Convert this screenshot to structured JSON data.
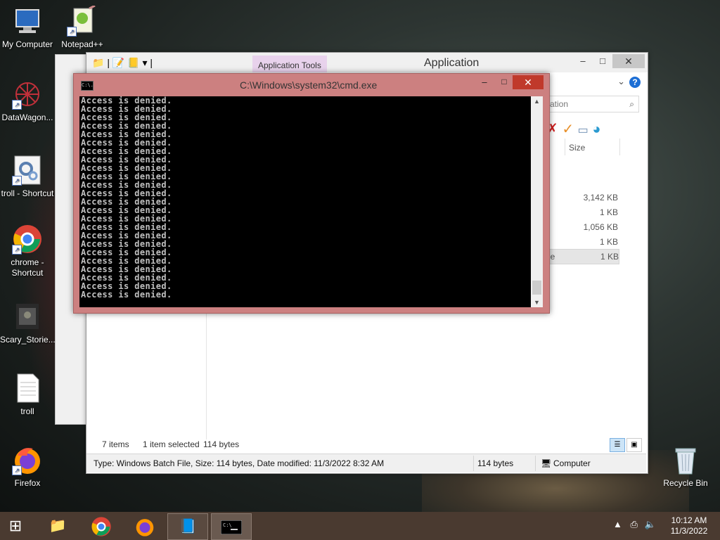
{
  "desktop": {
    "icons": [
      {
        "label": "My Computer"
      },
      {
        "label": "Notepad++"
      },
      {
        "label": "DataWagon..."
      },
      {
        "label": "troll - Shortcut"
      },
      {
        "label": "chrome - Shortcut"
      },
      {
        "label": "Scary_Storie..."
      },
      {
        "label": "troll"
      },
      {
        "label": "Firefox"
      },
      {
        "label": "Recycle Bin"
      }
    ]
  },
  "explorer": {
    "ribbon_context_tab": "Application Tools",
    "title": "Application",
    "search_fragment": "ation",
    "column_size": "Size",
    "rows": [
      {
        "size": "3,142 KB",
        "fragment": ""
      },
      {
        "size": "1 KB",
        "fragment": ""
      },
      {
        "size": "1,056 KB",
        "fragment": ""
      },
      {
        "size": "1 KB",
        "fragment": ""
      },
      {
        "size": "1 KB",
        "fragment": "le",
        "selected": true
      }
    ],
    "status": {
      "items": "7 items",
      "selected": "1 item selected",
      "selected_size": "114 bytes"
    },
    "details_bar": {
      "info": "Type: Windows Batch File, Size: 114 bytes, Date modified: 11/3/2022 8:32 AM",
      "size": "114 bytes",
      "location": "Computer"
    }
  },
  "cmd": {
    "title": "C:\\Windows\\system32\\cmd.exe",
    "lines": [
      "Access is denied.",
      "Access is denied.",
      "Access is denied.",
      "Access is denied.",
      "Access is denied.",
      "Access is denied.",
      "Access is denied.",
      "Access is denied.",
      "Access is denied.",
      "Access is denied.",
      "Access is denied.",
      "Access is denied.",
      "Access is denied.",
      "Access is denied.",
      "Access is denied.",
      "Access is denied.",
      "Access is denied.",
      "Access is denied.",
      "Access is denied.",
      "Access is denied.",
      "Access is denied.",
      "Access is denied.",
      "Access is denied.",
      "Access is denied."
    ],
    "icon_text": "C:\\."
  },
  "taskbar": {
    "time": "10:12 AM",
    "date": "11/3/2022"
  },
  "colors": {
    "cmd_frame": "#cc8080",
    "cmd_close": "#c0392b",
    "taskbar": "#4a3a30",
    "ribbon_tools": "#e8d2ec"
  }
}
